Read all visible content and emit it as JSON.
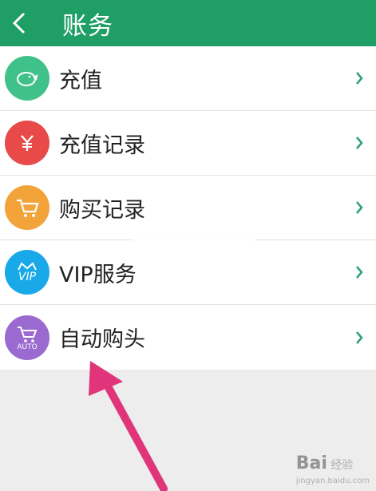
{
  "header": {
    "title": "账务",
    "back_icon": "chevron-left-icon",
    "bg_color": "#1f9f66"
  },
  "items": [
    {
      "label": "充值",
      "icon": "piggy-bank-icon",
      "color": "#40c18a"
    },
    {
      "label": "充值记录",
      "icon": "yuan-icon",
      "color": "#e84a4a"
    },
    {
      "label": "购买记录",
      "icon": "cart-icon",
      "color": "#f2a43a"
    },
    {
      "label": "VIP服务",
      "icon": "vip-crown-icon",
      "color": "#19a9e8",
      "icon_text": "VIP"
    },
    {
      "label": "自动购头",
      "icon": "auto-cart-icon",
      "color": "#9a6ad0",
      "icon_text": "AUTO"
    }
  ],
  "annotation": {
    "arrow_color": "#e0357a"
  },
  "watermark": {
    "brand": "Bai",
    "text": "经验",
    "sub": "jingyan.baidu.com"
  }
}
